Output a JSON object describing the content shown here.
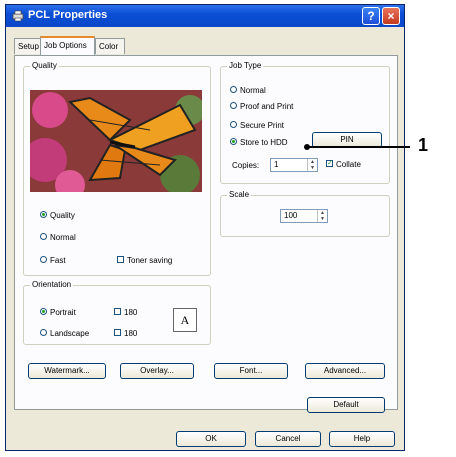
{
  "window": {
    "title": "PCL  Properties",
    "help": "?",
    "close": "×"
  },
  "tabs": [
    {
      "label": "Setup"
    },
    {
      "label": "Job Options"
    },
    {
      "label": "Color"
    }
  ],
  "quality": {
    "group_label": "Quality",
    "options": [
      {
        "label": "Quality",
        "selected": true
      },
      {
        "label": "Normal",
        "selected": false
      },
      {
        "label": "Fast",
        "selected": false
      }
    ],
    "toner_saving": {
      "label": "Toner saving",
      "checked": false
    }
  },
  "job_type": {
    "group_label": "Job Type",
    "options": [
      {
        "label": "Normal",
        "selected": false
      },
      {
        "label": "Proof and Print",
        "selected": false
      },
      {
        "label": "Secure Print",
        "selected": false
      },
      {
        "label": "Store to HDD",
        "selected": true
      }
    ],
    "pin_label": "PIN",
    "copies_label": "Copies:",
    "copies_value": "1",
    "collate": {
      "label": "Collate",
      "checked": true
    }
  },
  "scale": {
    "group_label": "Scale",
    "value": "100"
  },
  "orientation": {
    "group_label": "Orientation",
    "options": [
      {
        "label": "Portrait",
        "selected": true
      },
      {
        "label": "Landscape",
        "selected": false
      }
    ],
    "rotate_180": [
      {
        "label": "180",
        "checked": false
      },
      {
        "label": "180",
        "checked": false
      }
    ],
    "preview_letter": "A"
  },
  "buttons": {
    "watermark": "Watermark...",
    "overlay": "Overlay...",
    "font": "Font...",
    "advanced": "Advanced...",
    "default": "Default",
    "ok": "OK",
    "cancel": "Cancel",
    "help": "Help"
  },
  "callout": {
    "number": "1"
  }
}
